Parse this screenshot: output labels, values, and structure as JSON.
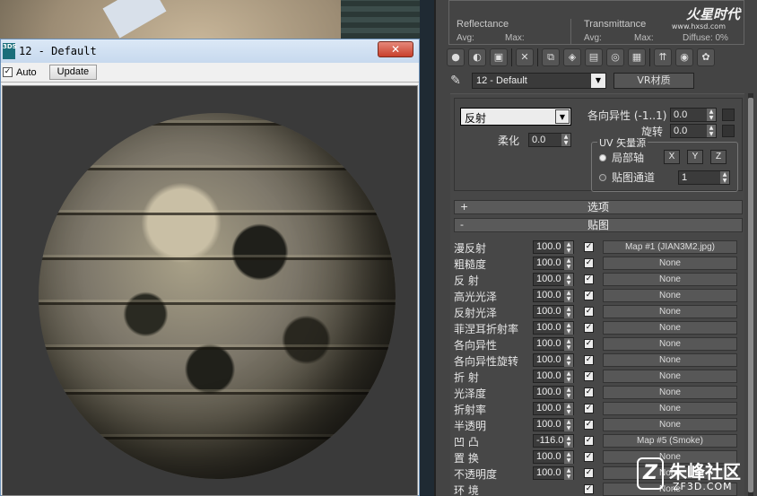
{
  "material_window": {
    "logo": "3DS",
    "title": "12 - Default",
    "close_glyph": "✕",
    "auto_checked_glyph": "✓",
    "auto_label": "Auto",
    "update_label": "Update"
  },
  "header": {
    "reflectance": "Reflectance",
    "transmittance": "Transmittance",
    "avg": "Avg:",
    "max": "Max:",
    "diffuse": "Diffuse: 0%",
    "watermark": "火星时代",
    "watermark_url": "www.hxsd.com"
  },
  "material_name": "12 - Default",
  "vr_material_label": "VR材质",
  "reflection": {
    "dropdown_value": "反射",
    "anisotropy_label": "各向异性 (-1..1)",
    "anisotropy_value": "0.0",
    "rotation_label": "旋转",
    "rotation_value": "0.0",
    "soften_label": "柔化",
    "soften_value": "0.0",
    "uv_title": "UV 矢量源",
    "local_axis_label": "局部轴",
    "axis_x": "X",
    "axis_y": "Y",
    "axis_z": "Z",
    "map_channel_label": "贴图通道",
    "map_channel_value": "1"
  },
  "sections": {
    "options_sign": "+",
    "options_title": "选项",
    "maps_sign": "-",
    "maps_title": "贴图"
  },
  "maps": [
    {
      "label": "漫反射",
      "amount": "100.0",
      "map": "Map #1 (JIAN3M2.jpg)"
    },
    {
      "label": "粗糙度",
      "amount": "100.0",
      "map": "None"
    },
    {
      "label": "反 射",
      "amount": "100.0",
      "map": "None"
    },
    {
      "label": "高光光泽",
      "amount": "100.0",
      "map": "None"
    },
    {
      "label": "反射光泽",
      "amount": "100.0",
      "map": "None"
    },
    {
      "label": "菲涅耳折射率",
      "amount": "100.0",
      "map": "None"
    },
    {
      "label": "各向异性",
      "amount": "100.0",
      "map": "None"
    },
    {
      "label": "各向异性旋转",
      "amount": "100.0",
      "map": "None"
    },
    {
      "label": "折 射",
      "amount": "100.0",
      "map": "None"
    },
    {
      "label": "光泽度",
      "amount": "100.0",
      "map": "None"
    },
    {
      "label": "折射率",
      "amount": "100.0",
      "map": "None"
    },
    {
      "label": "半透明",
      "amount": "100.0",
      "map": "None"
    },
    {
      "label": "凹 凸",
      "amount": "-116.0",
      "map": "Map #5 (Smoke)"
    },
    {
      "label": "置 换",
      "amount": "100.0",
      "map": "None"
    },
    {
      "label": "不透明度",
      "amount": "100.0",
      "map": "None"
    },
    {
      "label": "环 境",
      "amount": "",
      "map": "None"
    }
  ],
  "site_logo": {
    "name": "朱峰社区",
    "url": "ZF3D.COM"
  }
}
